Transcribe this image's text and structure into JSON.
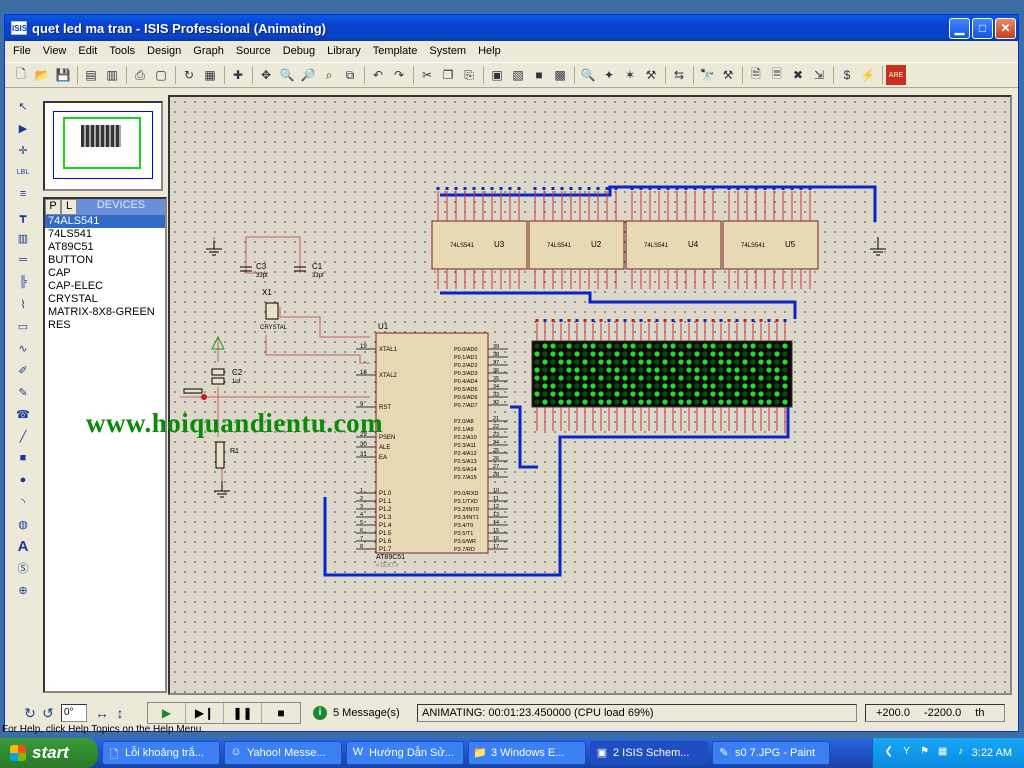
{
  "window": {
    "title": "quet led ma tran - ISIS Professional (Animating)",
    "app_icon": "ISIS"
  },
  "menu": [
    "File",
    "View",
    "Edit",
    "Tools",
    "Design",
    "Graph",
    "Source",
    "Debug",
    "Library",
    "Template",
    "System",
    "Help"
  ],
  "devices": {
    "tab_p": "P",
    "tab_l": "L",
    "title": "DEVICES",
    "items": [
      "74ALS541",
      "74LS541",
      "AT89C51",
      "BUTTON",
      "CAP",
      "CAP-ELEC",
      "CRYSTAL",
      "MATRIX-8X8-GREEN",
      "RES"
    ],
    "selected_index": 0
  },
  "schematic": {
    "u1_ref": "U1",
    "u1_part": "AT89C51",
    "u1_text": "<TEXT>",
    "buffers": [
      "U3",
      "U2",
      "U4",
      "U5"
    ],
    "buffer_part": "74LS541",
    "c3_ref": "C3",
    "c3_val": "33pf",
    "c1_ref": "C1",
    "c1_val": "33pf",
    "x1_ref": "X1",
    "x1_val": "CRYSTAL",
    "c2_ref": "C2",
    "c2_val": "1uf",
    "r_ref": "R1",
    "pins_left": [
      "XTAL1",
      "XTAL2",
      "RST",
      "PSEN",
      "ALE",
      "EA"
    ],
    "pins_left_nums": [
      "19",
      "18",
      "9",
      "29",
      "30",
      "31"
    ],
    "pins_p0": [
      "P0.0/AD0",
      "P0.1/AD1",
      "P0.2/AD2",
      "P0.3/AD3",
      "P0.4/AD4",
      "P0.5/AD5",
      "P0.6/AD6",
      "P0.7/AD7"
    ],
    "pins_p0_nums": [
      "39",
      "38",
      "37",
      "36",
      "35",
      "34",
      "33",
      "32"
    ],
    "pins_p2": [
      "P2.0/A8",
      "P2.1/A9",
      "P2.2/A10",
      "P2.3/A11",
      "P2.4/A12",
      "P2.5/A13",
      "P2.6/A14",
      "P2.7/A15"
    ],
    "pins_p2_nums": [
      "21",
      "22",
      "23",
      "24",
      "25",
      "26",
      "27",
      "28"
    ],
    "pins_p1": [
      "P1.0",
      "P1.1",
      "P1.2",
      "P1.3",
      "P1.4",
      "P1.5",
      "P1.6",
      "P1.7"
    ],
    "pins_p1_nums": [
      "1",
      "2",
      "3",
      "4",
      "5",
      "6",
      "7",
      "8"
    ],
    "pins_p3": [
      "P3.0/RXD",
      "P3.1/TXD",
      "P3.2/INT0",
      "P3.3/INT1",
      "P3.4/T0",
      "P3.5/T1",
      "P3.6/WR",
      "P3.7/RD"
    ],
    "pins_p3_nums": [
      "10",
      "11",
      "12",
      "13",
      "14",
      "15",
      "16",
      "17"
    ]
  },
  "watermark": "www.hoiquandientu.com",
  "status": {
    "angle": "0°",
    "messages": "5 Message(s)",
    "animating": "ANIMATING: 00:01:23.450000 (CPU load 69%)",
    "x": "+200.0",
    "y": "-2200.0",
    "unit": "th"
  },
  "help_text": "For Help, click Help Topics on the Help Menu.",
  "taskbar": {
    "start": "start",
    "tasks": [
      "Lỗi khoảng trắ...",
      "Yahoo! Messe...",
      "Hướng Dẫn Sử...",
      "3 Windows E...",
      "2 ISIS Schem...",
      "s0 7.JPG - Paint"
    ],
    "active_index": 4,
    "clock": "3:22 AM"
  }
}
